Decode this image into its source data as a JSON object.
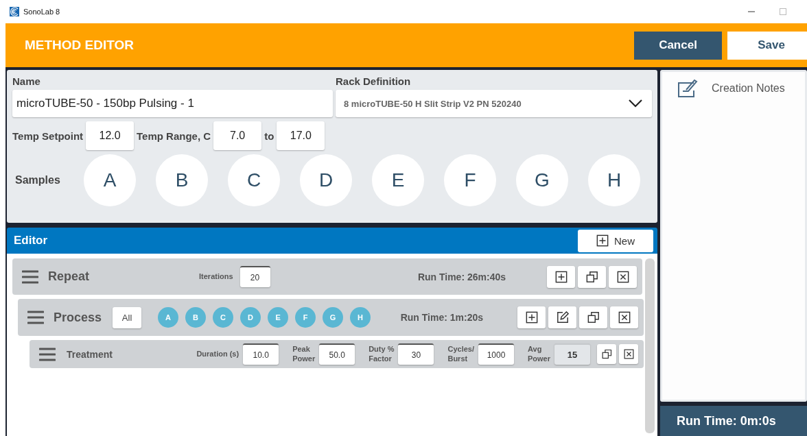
{
  "window": {
    "title": "SonoLab 8"
  },
  "header": {
    "title": "METHOD EDITOR",
    "buttons": [
      {
        "label": "Cancel",
        "kind": "secondary"
      },
      {
        "label": "Save",
        "kind": "primary"
      }
    ]
  },
  "method": {
    "name_label": "Name",
    "name_value": "microTUBE-50 - 150bp Pulsing - 1",
    "rack_label": "Rack Definition",
    "rack_value": "8 microTUBE-50 H Slit Strip V2 PN 520240",
    "temp_setpoint_label": "Temp Setpoint",
    "temp_setpoint": "12.0",
    "temp_range_label": "Temp Range, C",
    "temp_min": "7.0",
    "to_label": "to",
    "temp_max": "17.0",
    "samples_label": "Samples",
    "samples": [
      "A",
      "B",
      "C",
      "D",
      "E",
      "F",
      "G",
      "H"
    ]
  },
  "editor": {
    "title": "Editor",
    "new_button": "New",
    "repeat": {
      "title": "Repeat",
      "iterations_label": "Iterations",
      "iterations": "20",
      "run_time": "Run Time: 26m:40s",
      "actions": [
        {
          "kind": "add"
        },
        {
          "kind": "copy"
        },
        {
          "kind": "delete"
        }
      ]
    },
    "process": {
      "title": "Process",
      "all_button": "All",
      "samples": [
        {
          "label": "A",
          "selected": true
        },
        {
          "label": "B",
          "selected": true
        },
        {
          "label": "C",
          "selected": true
        },
        {
          "label": "D",
          "selected": true
        },
        {
          "label": "E",
          "selected": true
        },
        {
          "label": "F",
          "selected": true
        },
        {
          "label": "G",
          "selected": true
        },
        {
          "label": "H",
          "selected": true
        }
      ],
      "run_time": "Run Time: 1m:20s",
      "actions": [
        {
          "kind": "add"
        },
        {
          "kind": "edit"
        },
        {
          "kind": "copy"
        },
        {
          "kind": "delete"
        }
      ]
    },
    "treatment": {
      "title": "Treatment",
      "fields": [
        {
          "label": [
            "Duration (s)"
          ],
          "value": "10.0",
          "disabled": false
        },
        {
          "label": [
            "Peak",
            "Power"
          ],
          "value": "50.0",
          "disabled": false
        },
        {
          "label": [
            "Duty %",
            "Factor"
          ],
          "value": "30",
          "disabled": false
        },
        {
          "label": [
            "Cycles/",
            "Burst"
          ],
          "value": "1000",
          "disabled": false
        },
        {
          "label": [
            "Avg",
            "Power"
          ],
          "value": "15",
          "disabled": true
        }
      ],
      "actions": [
        {
          "kind": "copy"
        },
        {
          "kind": "delete"
        }
      ]
    }
  },
  "notes": {
    "title": "Creation Notes"
  },
  "status": {
    "run_time": "Run Time: 0m:0s"
  }
}
